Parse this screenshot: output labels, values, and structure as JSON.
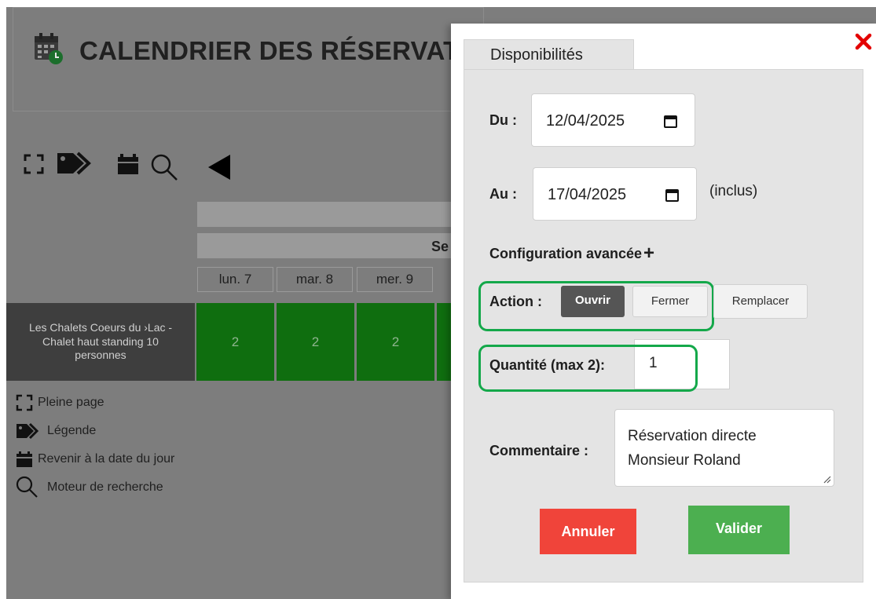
{
  "page": {
    "title": "CALENDRIER DES RÉSERVATIO"
  },
  "calendar": {
    "week_label": "Se",
    "days": [
      "lun. 7",
      "mar. 8",
      "mer. 9"
    ],
    "room": "Les Chalets Coeurs du ›Lac - Chalet haut standing 10 personnes",
    "availability": [
      "2",
      "2",
      "2"
    ]
  },
  "legend": {
    "fullscreen": "Pleine page",
    "legend": "Légende",
    "today": "Revenir à la date du jour",
    "search": "Moteur de recherche"
  },
  "modal": {
    "tab": "Disponibilités",
    "from_label": "Du :",
    "from_value": "12/04/2025",
    "to_label": "Au :",
    "to_value": "17/04/2025",
    "inclusive": "(inclus)",
    "advanced": "Configuration avancée",
    "action_label": "Action :",
    "actions": [
      "Ouvrir",
      "Fermer",
      "Remplacer"
    ],
    "selected_action": "Ouvrir",
    "quantity_label": "Quantité (max 2):",
    "quantity_value": "1",
    "comment_label": "Commentaire :",
    "comment_line1": "Réservation directe",
    "comment_line2": "Monsieur Roland",
    "cancel": "Annuler",
    "submit": "Valider"
  },
  "colors": {
    "backdrop": "#7d7d7d",
    "available_cell": "#0f6e0f",
    "highlight": "#14a84a",
    "cancel": "#f0443a",
    "submit": "#4caf50",
    "close": "#e30000"
  }
}
